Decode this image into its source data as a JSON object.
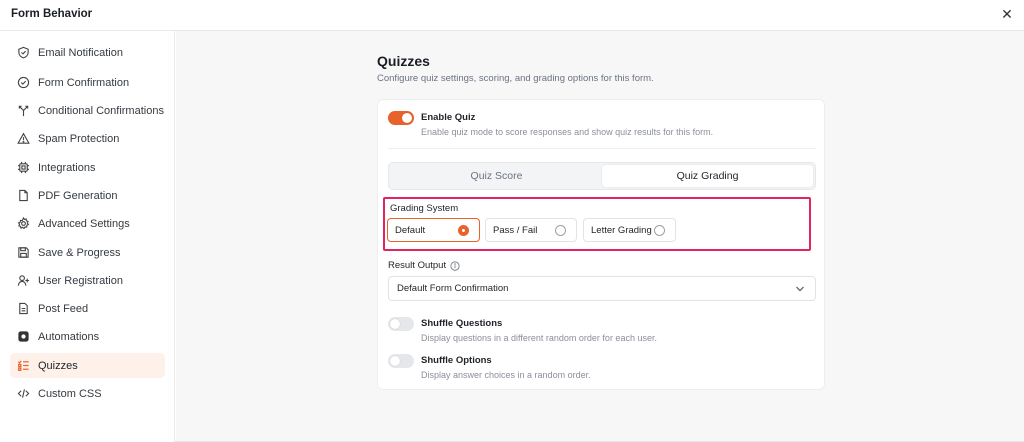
{
  "window": {
    "title": "Form Behavior",
    "close_icon": "close-icon"
  },
  "sidebar": {
    "items": [
      {
        "label": "Email Notification",
        "icon": "shield-check-icon"
      },
      {
        "label": "Form Confirmation",
        "icon": "check-circle-icon"
      },
      {
        "label": "Conditional Confirmations",
        "icon": "branch-icon"
      },
      {
        "label": "Spam Protection",
        "icon": "warning-triangle-icon"
      },
      {
        "label": "Integrations",
        "icon": "chip-icon"
      },
      {
        "label": "PDF Generation",
        "icon": "document-icon"
      },
      {
        "label": "Advanced Settings",
        "icon": "gear-icon"
      },
      {
        "label": "Save & Progress",
        "icon": "save-icon"
      },
      {
        "label": "User Registration",
        "icon": "user-plus-icon"
      },
      {
        "label": "Post Feed",
        "icon": "page-icon"
      },
      {
        "label": "Automations",
        "icon": "automation-icon"
      },
      {
        "label": "Quizzes",
        "icon": "quiz-list-icon",
        "active": true
      },
      {
        "label": "Custom CSS",
        "icon": "code-icon"
      }
    ]
  },
  "main": {
    "title": "Quizzes",
    "subtitle": "Configure quiz settings, scoring, and grading options for this form.",
    "enable_quiz": {
      "label": "Enable Quiz",
      "description": "Enable quiz mode to score responses and show quiz results for this form.",
      "enabled": true
    },
    "tabs": [
      {
        "label": "Quiz Score",
        "active": false
      },
      {
        "label": "Quiz Grading",
        "active": true
      }
    ],
    "grading": {
      "label": "Grading System",
      "options": [
        {
          "label": "Default",
          "selected": true
        },
        {
          "label": "Pass / Fail",
          "selected": false
        },
        {
          "label": "Letter Grading",
          "selected": false
        }
      ]
    },
    "result_output": {
      "label": "Result Output",
      "value": "Default Form Confirmation"
    },
    "shuffle_questions": {
      "label": "Shuffle Questions",
      "description": "Display questions in a different random order for each user.",
      "enabled": false
    },
    "shuffle_options": {
      "label": "Shuffle Options",
      "description": "Display answer choices in a random order.",
      "enabled": false
    }
  },
  "colors": {
    "accent": "#e8622c",
    "highlight": "#e0245e",
    "active_nav_bg": "#fdf1ea"
  }
}
